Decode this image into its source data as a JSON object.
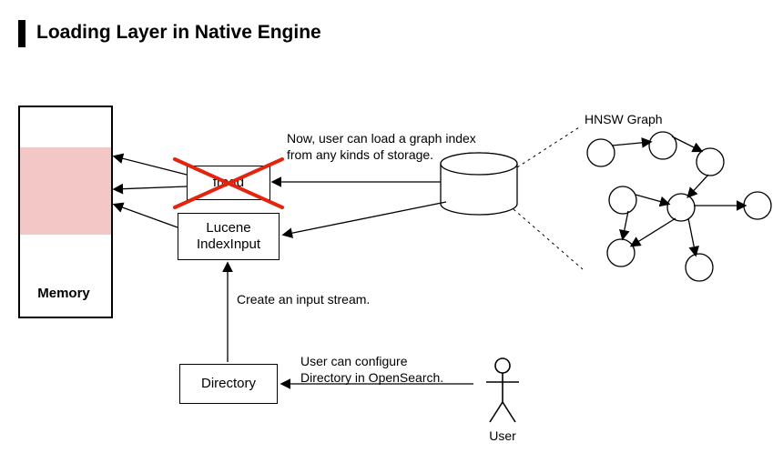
{
  "title": "Loading Layer in Native Engine",
  "memory": {
    "label": "Memory"
  },
  "boxes": {
    "fread": "fread",
    "lucene_line1": "Lucene",
    "lucene_line2": "IndexInput",
    "directory": "Directory",
    "storage": "Storage"
  },
  "annotations": {
    "load_graph_line1": "Now, user can load a graph index",
    "load_graph_line2": "from any kinds of storage.",
    "create_stream": "Create an input stream.",
    "configure_line1": "User can configure",
    "configure_line2": "Directory in OpenSearch.",
    "hnsw_label": "HNSW Graph",
    "user_label": "User"
  }
}
